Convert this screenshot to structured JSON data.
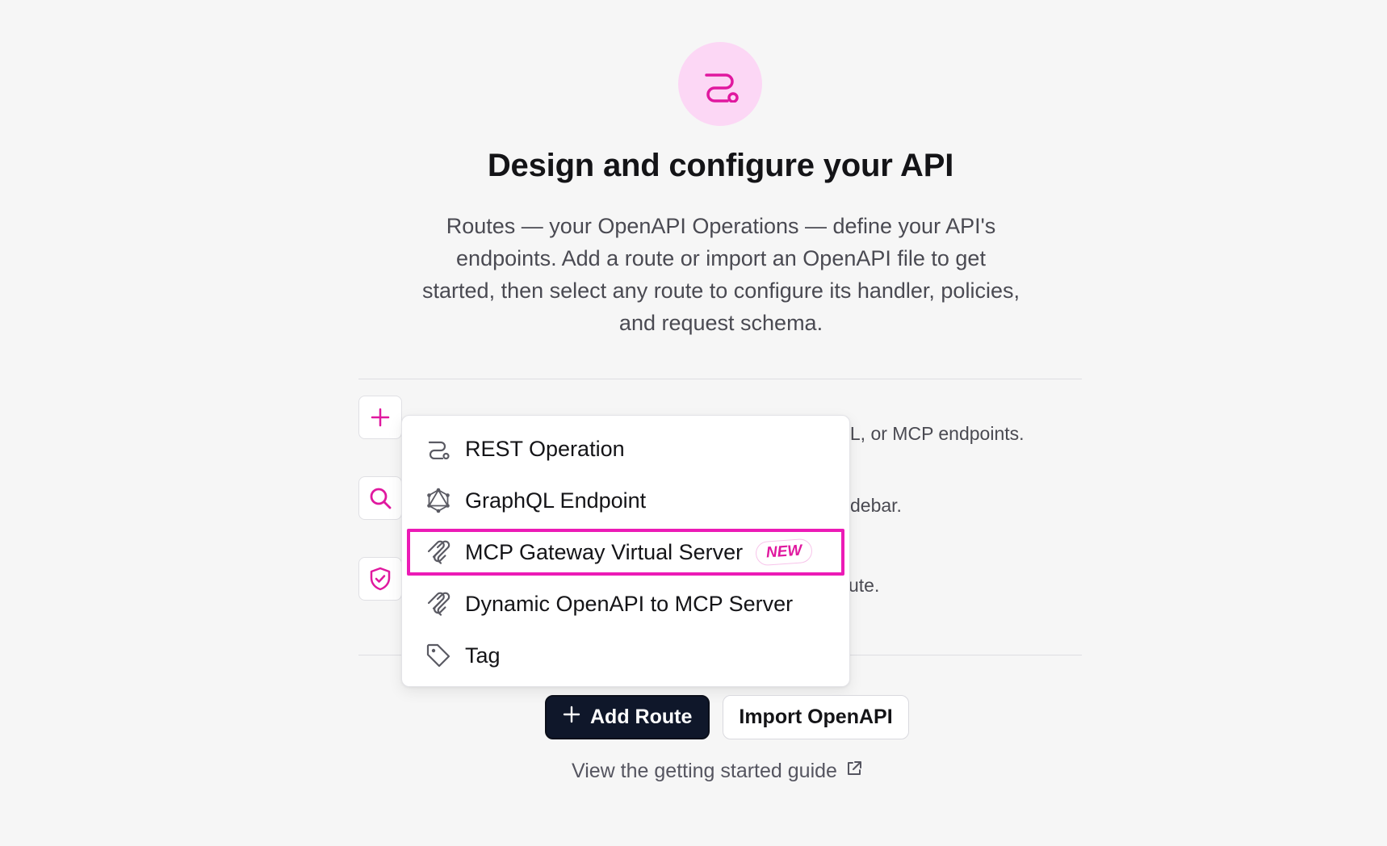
{
  "hero": {
    "icon": "route-icon",
    "title": "Design and configure your API",
    "description": "Routes — your OpenAPI Operations — define your API's endpoints. Add a route or import an OpenAPI file to get started, then select any route to configure its handler, policies, and request schema."
  },
  "steps": [
    {
      "icon": "plus-icon",
      "visible_text": "QL, or MCP endpoints."
    },
    {
      "icon": "search-icon",
      "visible_text": "debar."
    },
    {
      "icon": "shield-check-icon",
      "visible_text": "ute."
    }
  ],
  "menu": {
    "items": [
      {
        "label": "REST Operation",
        "icon": "route-icon"
      },
      {
        "label": "GraphQL Endpoint",
        "icon": "graphql-icon"
      },
      {
        "label": "MCP Gateway Virtual Server",
        "icon": "mcp-icon",
        "badge": "NEW",
        "highlighted": true
      },
      {
        "label": "Dynamic OpenAPI to MCP Server",
        "icon": "mcp-icon"
      },
      {
        "label": "Tag",
        "icon": "tag-icon"
      }
    ]
  },
  "actions": {
    "add_route": "Add Route",
    "import_openapi": "Import OpenAPI"
  },
  "guide_link": "View the getting started guide",
  "colors": {
    "accent": "#e0189f",
    "highlight_border": "#ec1bb6",
    "primary_button": "#0f172a",
    "hero_icon_bg": "#fcd7f5"
  }
}
